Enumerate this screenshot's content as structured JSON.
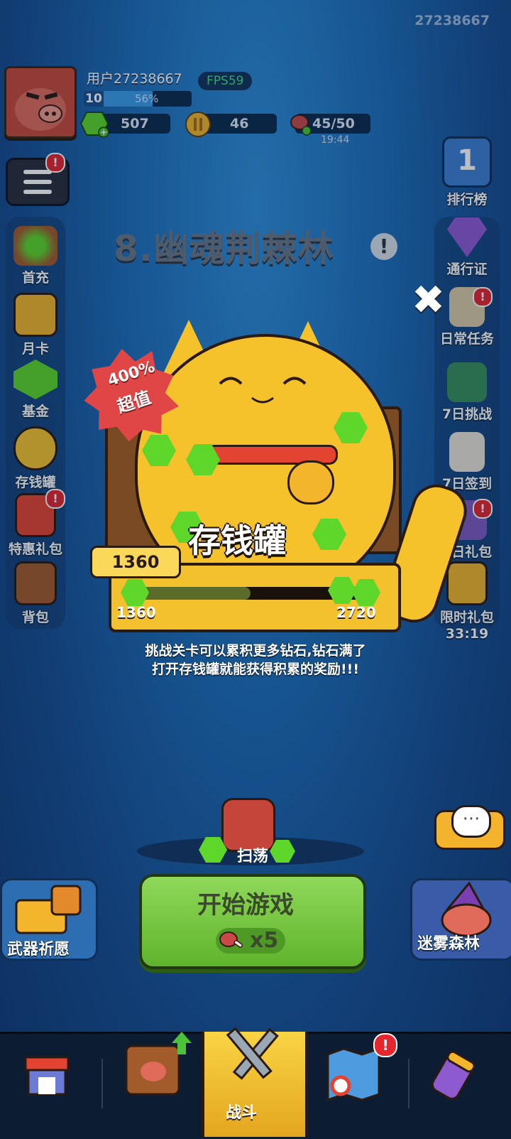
{
  "user_id_corner": "27238667",
  "header": {
    "username": "用户27238667",
    "fps": "FPS59",
    "level": "10",
    "xp_percent": "56%",
    "xp_fraction": 0.56,
    "gems": "507",
    "coins": "46",
    "stamina": "45/50",
    "stamina_timer": "19:44"
  },
  "stage_title": "8.幽魂荆棘林",
  "left_menu": [
    "首充",
    "月卡",
    "基金",
    "存钱罐",
    "特惠礼包",
    "背包"
  ],
  "right_menu": {
    "rank": "排行榜",
    "rank_num": "1",
    "pass": "通行证",
    "daily": "日常任务",
    "challenge7": "7日挑战",
    "signin7": "7日签到",
    "gift7": "7日礼包",
    "limited": "限时礼包",
    "limited_timer": "33:19",
    "badge": "!"
  },
  "piggy": {
    "title": "存钱罐",
    "deal_line1": "400%",
    "deal_line2": "超值",
    "current": "1360",
    "min": "1360",
    "max": "2720",
    "progress_fraction": 0.5,
    "description_line1": "挑战关卡可以累积更多钻石,钻石满了",
    "description_line2": "打开存钱罐就能获得积累的奖励!!!",
    "close": "✖"
  },
  "bottom": {
    "sweep": "扫荡",
    "start": "开始游戏",
    "start_cost": "x5",
    "weapon_wish": "武器祈愿",
    "fog_forest": "迷雾森林",
    "chat_icon": "···"
  },
  "nav": {
    "battle": "战斗"
  },
  "colors": {
    "background": "#1f6fb8",
    "accent_yellow": "#f3c12d",
    "start_green": "#6dc435",
    "badge_red": "#e5262f"
  }
}
